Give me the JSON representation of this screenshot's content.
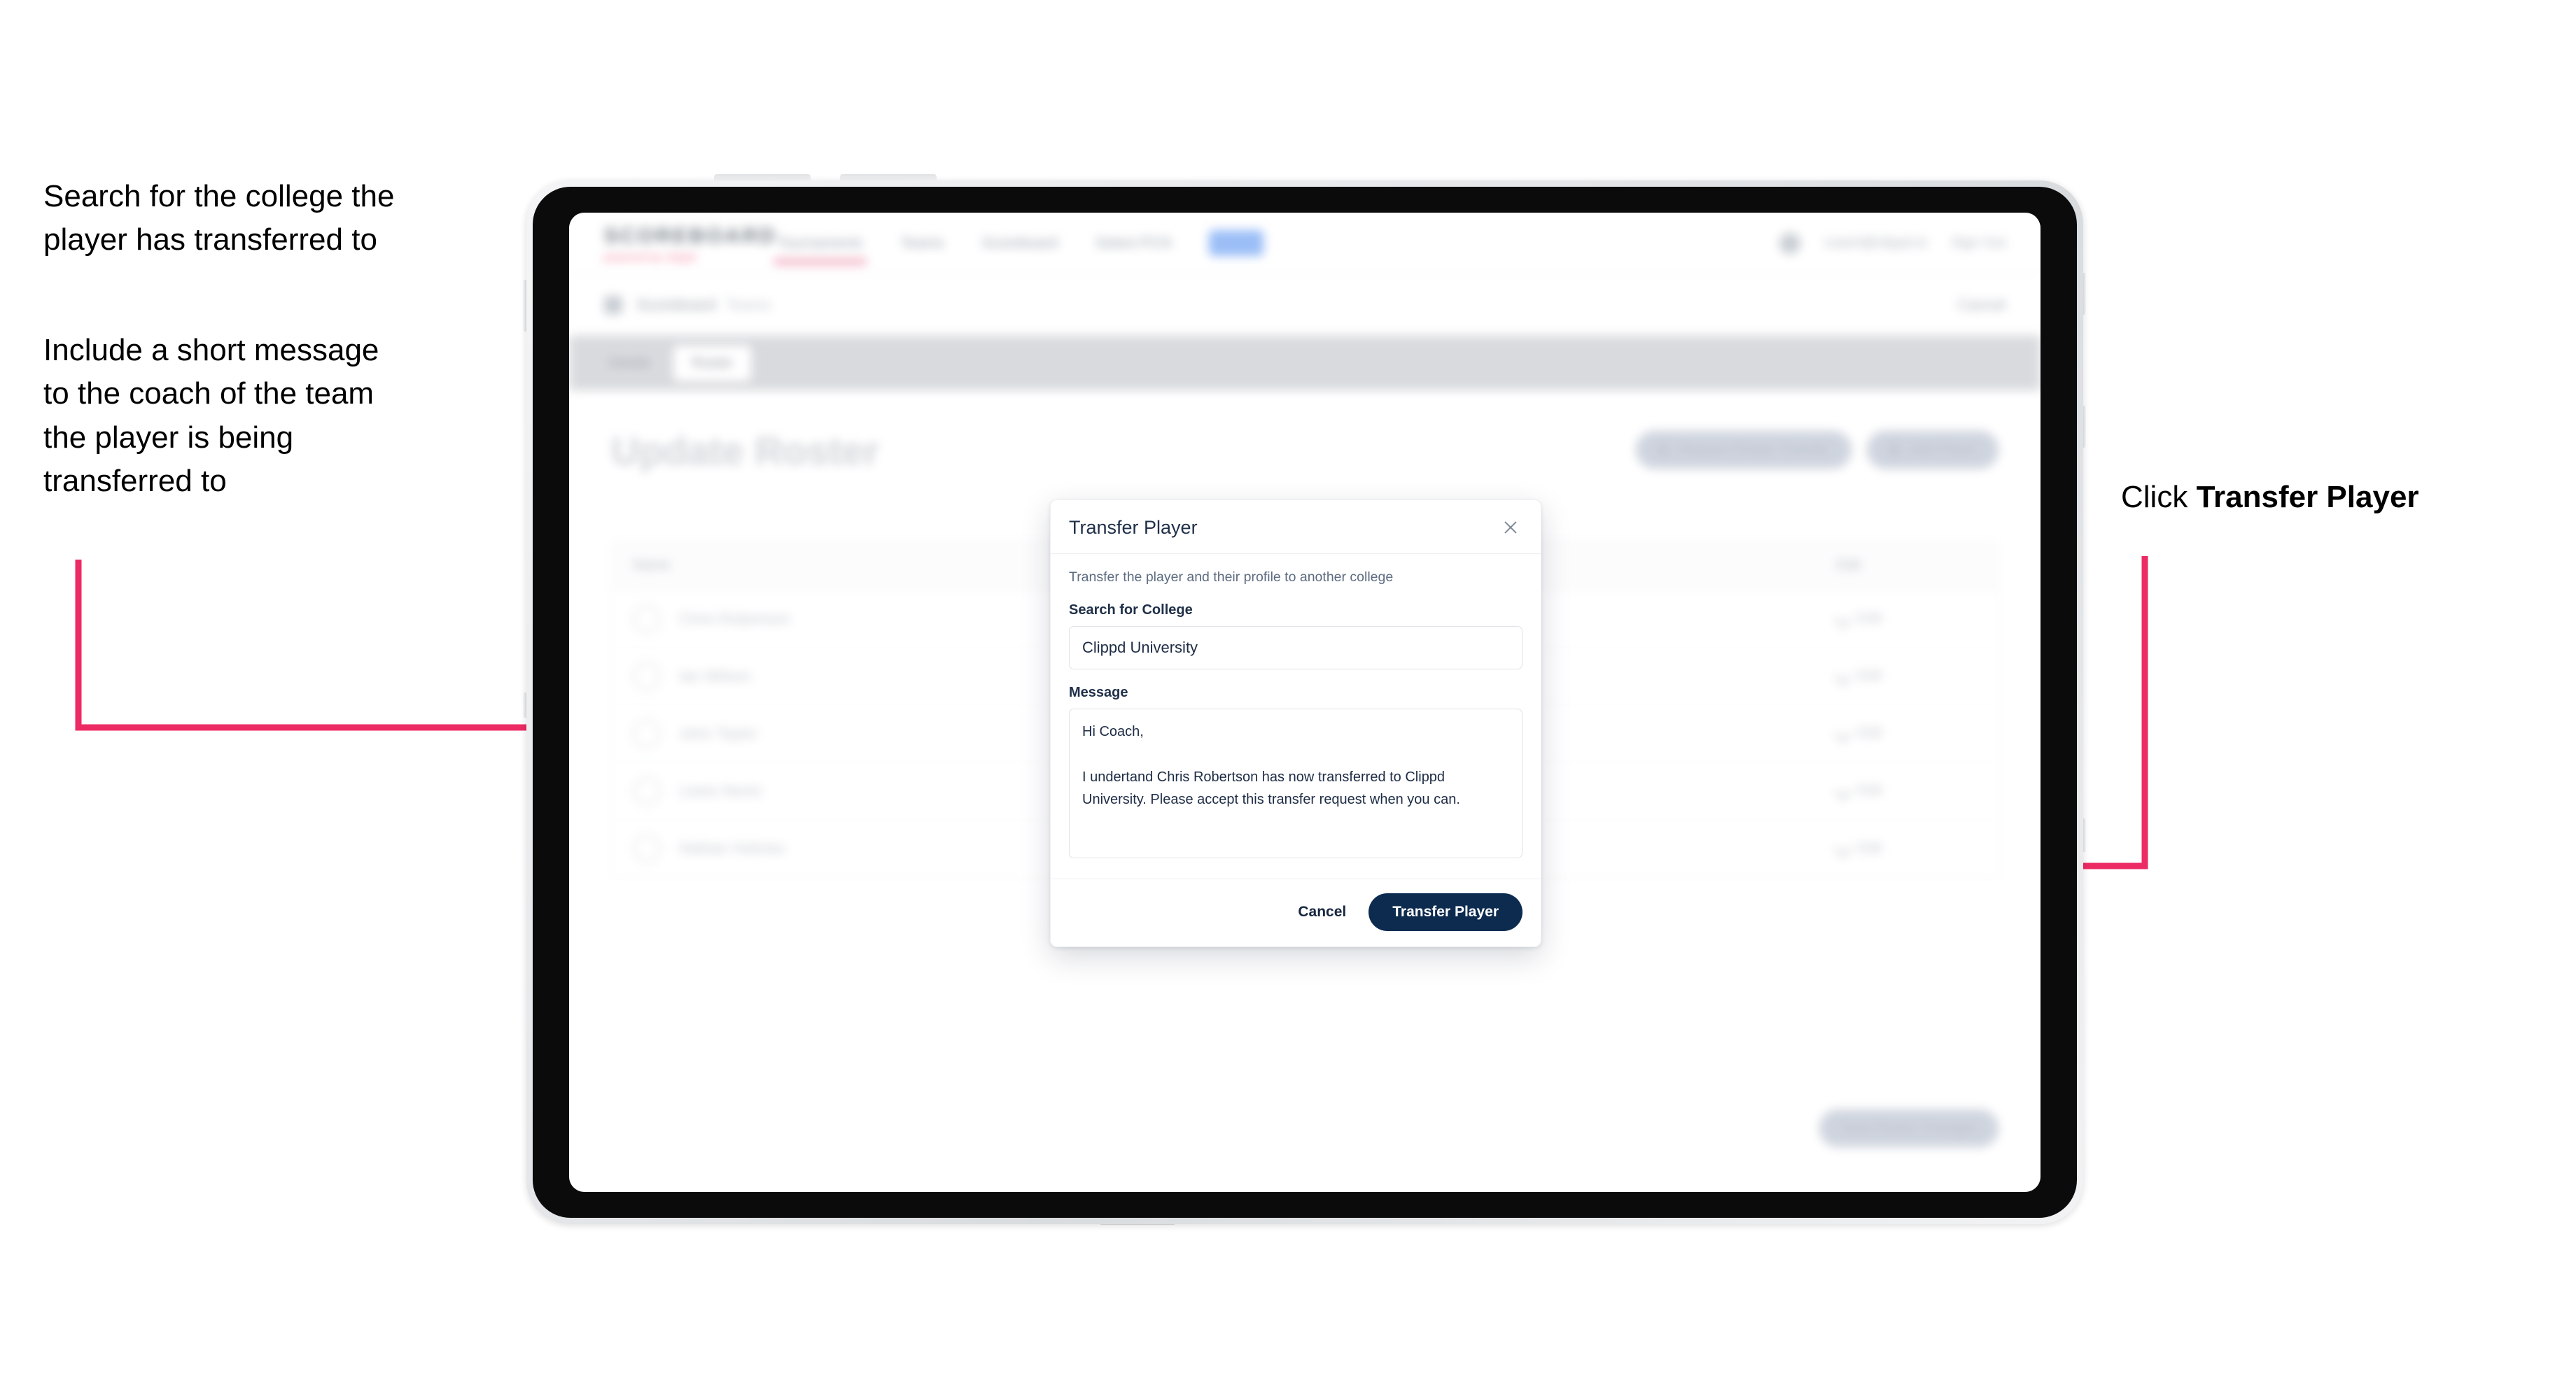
{
  "annotations": {
    "left_1": "Search for the college the\nplayer has transferred to",
    "left_2": "Include a short message\nto the coach of the team\nthe player is being\ntransferred to",
    "right_1_prefix": "Click ",
    "right_1_bold": "Transfer Player"
  },
  "colors": {
    "arrow_pink": "#EC2A63",
    "primary_navy": "#0D2B4F",
    "nav_badge_blue": "#93B9F7",
    "logo_accent_pink": "#F2718F"
  },
  "app": {
    "logo": {
      "main": "SCOREBOARD",
      "sub_prefix": "powered by ",
      "sub_accent": "clippd"
    },
    "nav": [
      {
        "label": "Tournaments",
        "active": false
      },
      {
        "label": "Teams",
        "active": true
      },
      {
        "label": "Scoreboard",
        "active": false
      },
      {
        "label": "Select PCN",
        "active": false
      },
      {
        "label": "Beta",
        "badge": true
      }
    ],
    "header_right": {
      "user": "coach@clippd.io",
      "sign_out": "Sign Out"
    },
    "breadcrumb": {
      "label": "Scoreboard",
      "sub": "Teams",
      "right_action": "Cancel"
    },
    "tabs": [
      {
        "label": "Details",
        "active": false
      },
      {
        "label": "Roster",
        "active": true
      }
    ],
    "page_title": "Update Roster",
    "toolbar_buttons": [
      {
        "label": "Request Roster Transfer",
        "icon": "search-icon"
      },
      {
        "label": "Add Player",
        "icon": "plus-icon"
      }
    ],
    "roster": {
      "columns": {
        "name": "Name",
        "edit": "Edit"
      },
      "rows": [
        {
          "name": "Chris Robertson",
          "action": "Edit"
        },
        {
          "name": "Ian Wilson",
          "action": "Edit"
        },
        {
          "name": "John Taylor",
          "action": "Edit"
        },
        {
          "name": "Lewis Nevin",
          "action": "Edit"
        },
        {
          "name": "Nathan Holmes",
          "action": "Edit"
        }
      ]
    },
    "bottom_button": "Save Roster Changes"
  },
  "modal": {
    "title": "Transfer Player",
    "close_icon": "close-icon",
    "subtitle": "Transfer the player and their profile to another college",
    "college_label": "Search for College",
    "college_value": "Clippd University",
    "college_placeholder": "Search for College",
    "message_label": "Message",
    "message_value": "Hi Coach,\n\nI undertand Chris Robertson has now transferred to Clippd University. Please accept this transfer request when you can.",
    "message_placeholder": "Message",
    "cancel_label": "Cancel",
    "submit_label": "Transfer Player"
  }
}
